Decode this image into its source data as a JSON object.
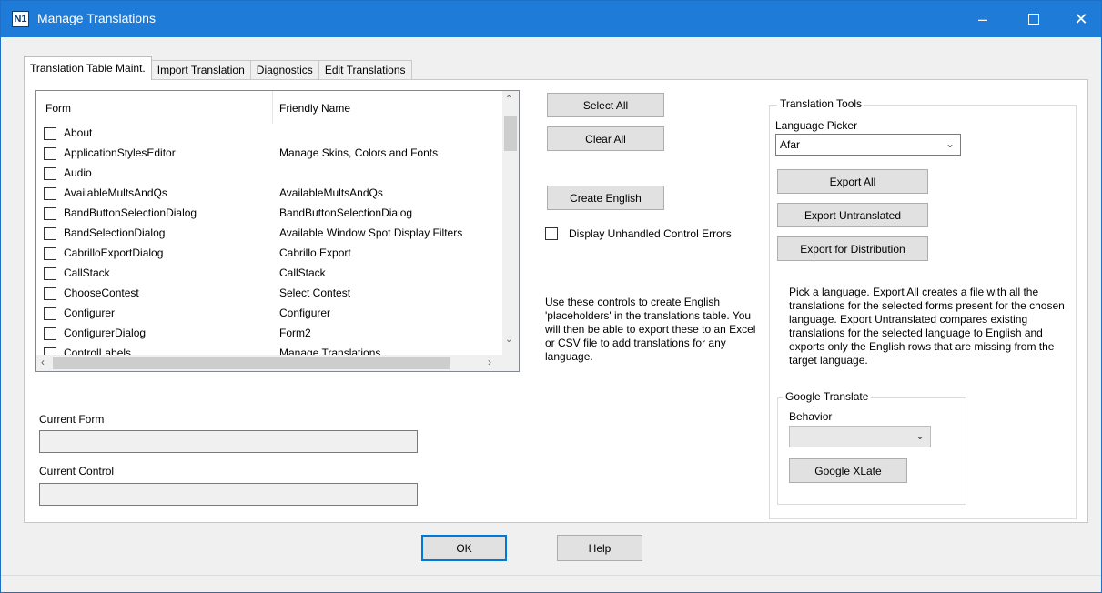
{
  "window": {
    "title": "Manage Translations",
    "app_icon_text": "N1",
    "minimize_icon": "minimize-icon",
    "maximize_icon": "maximize-icon",
    "close_icon": "close-icon"
  },
  "tabs": [
    {
      "label": "Translation Table Maint.",
      "active": true
    },
    {
      "label": "Import Translation",
      "active": false
    },
    {
      "label": "Diagnostics",
      "active": false
    },
    {
      "label": "Edit Translations",
      "active": false
    }
  ],
  "list": {
    "columns": [
      "Form",
      "Friendly Name"
    ],
    "rows": [
      {
        "form": "About",
        "friendly": "",
        "checked": false
      },
      {
        "form": "ApplicationStylesEditor",
        "friendly": "Manage Skins, Colors and Fonts",
        "checked": false
      },
      {
        "form": "Audio",
        "friendly": "",
        "checked": false
      },
      {
        "form": "AvailableMultsAndQs",
        "friendly": "AvailableMultsAndQs",
        "checked": false
      },
      {
        "form": "BandButtonSelectionDialog",
        "friendly": "BandButtonSelectionDialog",
        "checked": false
      },
      {
        "form": "BandSelectionDialog",
        "friendly": "Available Window Spot Display Filters",
        "checked": false
      },
      {
        "form": "CabrilloExportDialog",
        "friendly": "Cabrillo Export",
        "checked": false
      },
      {
        "form": "CallStack",
        "friendly": "CallStack",
        "checked": false
      },
      {
        "form": "ChooseContest",
        "friendly": "Select Contest",
        "checked": false
      },
      {
        "form": "Configurer",
        "friendly": "Configurer",
        "checked": false
      },
      {
        "form": "ConfigurerDialog",
        "friendly": "Form2",
        "checked": false
      },
      {
        "form": "ControlLabels",
        "friendly": "Manage Translations",
        "checked": false
      }
    ]
  },
  "left_bottom": {
    "current_form_label": "Current Form",
    "current_form_value": "",
    "current_control_label": "Current Control",
    "current_control_value": ""
  },
  "middle": {
    "select_all": "Select All",
    "clear_all": "Clear All",
    "create_english": "Create English",
    "display_errors_label": "Display Unhandled Control Errors",
    "display_errors_checked": false,
    "info": "Use these controls to create English 'placeholders' in the translations table. You will then be able to export these to an Excel or CSV file to add translations for any language."
  },
  "tools": {
    "group_title": "Translation Tools",
    "language_picker_label": "Language Picker",
    "language_selected": "Afar",
    "export_all": "Export All",
    "export_untranslated": "Export Untranslated",
    "export_distribution": "Export for Distribution",
    "info": "Pick a language. Export All creates a file with all the translations for the selected forms present for the chosen language. Export Untranslated compares existing translations for the selected language to English and exports only the English rows that are missing from the target language.",
    "google": {
      "group_title": "Google Translate",
      "behavior_label": "Behavior",
      "behavior_value": "",
      "xlate_button": "Google XLate"
    }
  },
  "footer": {
    "ok": "OK",
    "help": "Help"
  }
}
